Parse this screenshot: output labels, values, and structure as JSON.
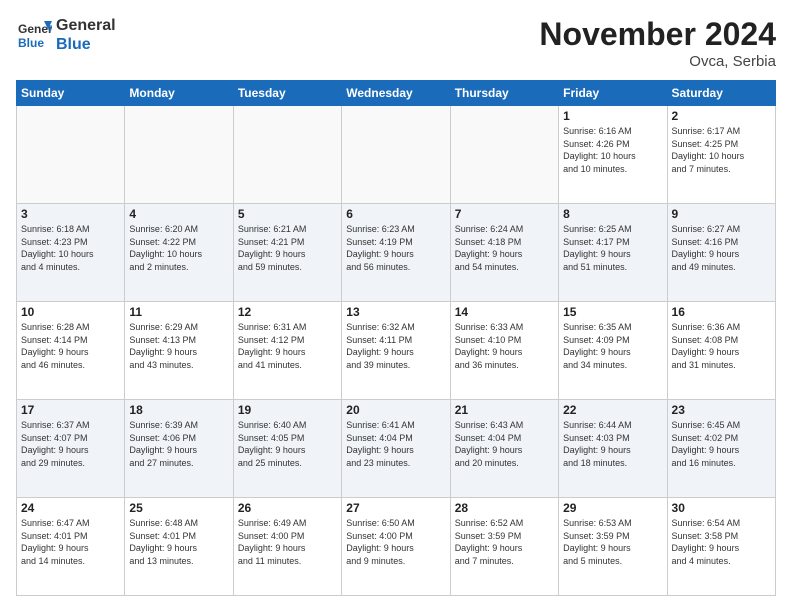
{
  "header": {
    "logo_line1": "General",
    "logo_line2": "Blue",
    "month_title": "November 2024",
    "location": "Ovca, Serbia"
  },
  "weekdays": [
    "Sunday",
    "Monday",
    "Tuesday",
    "Wednesday",
    "Thursday",
    "Friday",
    "Saturday"
  ],
  "weeks": [
    [
      {
        "num": "",
        "info": ""
      },
      {
        "num": "",
        "info": ""
      },
      {
        "num": "",
        "info": ""
      },
      {
        "num": "",
        "info": ""
      },
      {
        "num": "",
        "info": ""
      },
      {
        "num": "1",
        "info": "Sunrise: 6:16 AM\nSunset: 4:26 PM\nDaylight: 10 hours\nand 10 minutes."
      },
      {
        "num": "2",
        "info": "Sunrise: 6:17 AM\nSunset: 4:25 PM\nDaylight: 10 hours\nand 7 minutes."
      }
    ],
    [
      {
        "num": "3",
        "info": "Sunrise: 6:18 AM\nSunset: 4:23 PM\nDaylight: 10 hours\nand 4 minutes."
      },
      {
        "num": "4",
        "info": "Sunrise: 6:20 AM\nSunset: 4:22 PM\nDaylight: 10 hours\nand 2 minutes."
      },
      {
        "num": "5",
        "info": "Sunrise: 6:21 AM\nSunset: 4:21 PM\nDaylight: 9 hours\nand 59 minutes."
      },
      {
        "num": "6",
        "info": "Sunrise: 6:23 AM\nSunset: 4:19 PM\nDaylight: 9 hours\nand 56 minutes."
      },
      {
        "num": "7",
        "info": "Sunrise: 6:24 AM\nSunset: 4:18 PM\nDaylight: 9 hours\nand 54 minutes."
      },
      {
        "num": "8",
        "info": "Sunrise: 6:25 AM\nSunset: 4:17 PM\nDaylight: 9 hours\nand 51 minutes."
      },
      {
        "num": "9",
        "info": "Sunrise: 6:27 AM\nSunset: 4:16 PM\nDaylight: 9 hours\nand 49 minutes."
      }
    ],
    [
      {
        "num": "10",
        "info": "Sunrise: 6:28 AM\nSunset: 4:14 PM\nDaylight: 9 hours\nand 46 minutes."
      },
      {
        "num": "11",
        "info": "Sunrise: 6:29 AM\nSunset: 4:13 PM\nDaylight: 9 hours\nand 43 minutes."
      },
      {
        "num": "12",
        "info": "Sunrise: 6:31 AM\nSunset: 4:12 PM\nDaylight: 9 hours\nand 41 minutes."
      },
      {
        "num": "13",
        "info": "Sunrise: 6:32 AM\nSunset: 4:11 PM\nDaylight: 9 hours\nand 39 minutes."
      },
      {
        "num": "14",
        "info": "Sunrise: 6:33 AM\nSunset: 4:10 PM\nDaylight: 9 hours\nand 36 minutes."
      },
      {
        "num": "15",
        "info": "Sunrise: 6:35 AM\nSunset: 4:09 PM\nDaylight: 9 hours\nand 34 minutes."
      },
      {
        "num": "16",
        "info": "Sunrise: 6:36 AM\nSunset: 4:08 PM\nDaylight: 9 hours\nand 31 minutes."
      }
    ],
    [
      {
        "num": "17",
        "info": "Sunrise: 6:37 AM\nSunset: 4:07 PM\nDaylight: 9 hours\nand 29 minutes."
      },
      {
        "num": "18",
        "info": "Sunrise: 6:39 AM\nSunset: 4:06 PM\nDaylight: 9 hours\nand 27 minutes."
      },
      {
        "num": "19",
        "info": "Sunrise: 6:40 AM\nSunset: 4:05 PM\nDaylight: 9 hours\nand 25 minutes."
      },
      {
        "num": "20",
        "info": "Sunrise: 6:41 AM\nSunset: 4:04 PM\nDaylight: 9 hours\nand 23 minutes."
      },
      {
        "num": "21",
        "info": "Sunrise: 6:43 AM\nSunset: 4:04 PM\nDaylight: 9 hours\nand 20 minutes."
      },
      {
        "num": "22",
        "info": "Sunrise: 6:44 AM\nSunset: 4:03 PM\nDaylight: 9 hours\nand 18 minutes."
      },
      {
        "num": "23",
        "info": "Sunrise: 6:45 AM\nSunset: 4:02 PM\nDaylight: 9 hours\nand 16 minutes."
      }
    ],
    [
      {
        "num": "24",
        "info": "Sunrise: 6:47 AM\nSunset: 4:01 PM\nDaylight: 9 hours\nand 14 minutes."
      },
      {
        "num": "25",
        "info": "Sunrise: 6:48 AM\nSunset: 4:01 PM\nDaylight: 9 hours\nand 13 minutes."
      },
      {
        "num": "26",
        "info": "Sunrise: 6:49 AM\nSunset: 4:00 PM\nDaylight: 9 hours\nand 11 minutes."
      },
      {
        "num": "27",
        "info": "Sunrise: 6:50 AM\nSunset: 4:00 PM\nDaylight: 9 hours\nand 9 minutes."
      },
      {
        "num": "28",
        "info": "Sunrise: 6:52 AM\nSunset: 3:59 PM\nDaylight: 9 hours\nand 7 minutes."
      },
      {
        "num": "29",
        "info": "Sunrise: 6:53 AM\nSunset: 3:59 PM\nDaylight: 9 hours\nand 5 minutes."
      },
      {
        "num": "30",
        "info": "Sunrise: 6:54 AM\nSunset: 3:58 PM\nDaylight: 9 hours\nand 4 minutes."
      }
    ]
  ]
}
